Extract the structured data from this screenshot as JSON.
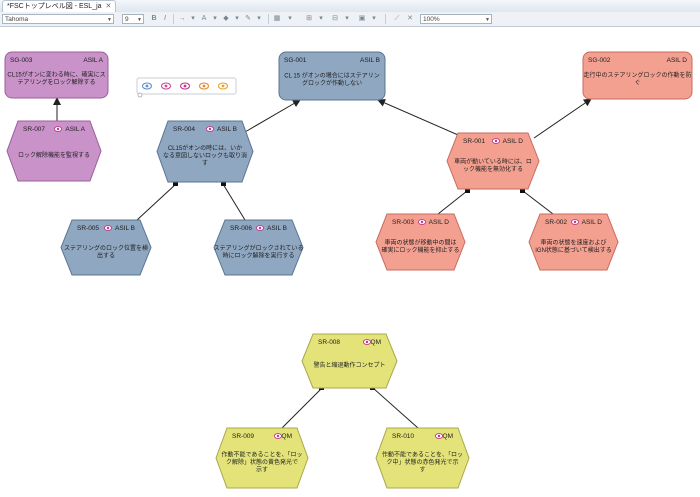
{
  "tab": {
    "title": "*FSCトップレベル図 - ESL_ja",
    "close": "✕"
  },
  "toolbar": {
    "font": "Tahoma",
    "size": "9",
    "zoom": "100%"
  },
  "palette": {
    "colors": [
      "#5b8fd6",
      "#d14b9b",
      "#c2388e",
      "#e88a2b",
      "#e5a52f"
    ]
  },
  "nodes": [
    {
      "id": "SG-003",
      "asil": "ASIL A",
      "text1": "CL15がオンに変わる時に、確実にス",
      "text2": "テアリングをロック解除する",
      "fill": "#c992c9",
      "stroke": "#9b5f9b"
    },
    {
      "id": "SG-001",
      "asil": "ASIL B",
      "text1": "CL 15 がオンの場合にはステアリン",
      "text2": "グロックが作動しない",
      "fill": "#8fa7c0",
      "stroke": "#5b7591"
    },
    {
      "id": "SG-002",
      "asil": "ASIL D",
      "text1": "走行中のステアリングロックの作動を防",
      "text2": "ぐ",
      "fill": "#f4a091",
      "stroke": "#c96a5d"
    },
    {
      "id": "SR-007",
      "asil": "ASIL A",
      "text1": "ロック解除機能を監視する",
      "text2": "",
      "fill": "#c992c9",
      "stroke": "#9b5f9b"
    },
    {
      "id": "SR-004",
      "asil": "ASIL B",
      "text1": "CL15がオンの時には、いか",
      "text2": "なる意図しないロックも取り消",
      "text3": "す",
      "fill": "#8fa7c0",
      "stroke": "#5b7591"
    },
    {
      "id": "SR-001",
      "asil": "ASIL D",
      "text1": "車両が動いている時には、ロ",
      "text2": "ック機能を無効化する",
      "fill": "#f4a091",
      "stroke": "#c96a5d"
    },
    {
      "id": "SR-005",
      "asil": "ASIL B",
      "text1": "ステアリングのロック位置を検",
      "text2": "出する",
      "fill": "#8fa7c0",
      "stroke": "#5b7591"
    },
    {
      "id": "SR-006",
      "asil": "ASIL B",
      "text1": "ステアリングがロックされている",
      "text2": "時にロック解除を実行する",
      "fill": "#8fa7c0",
      "stroke": "#5b7591"
    },
    {
      "id": "SR-003",
      "asil": "ASIL D",
      "text1": "車両の状態が移動中の間は",
      "text2": "確実にロック機能を抑止する",
      "fill": "#f4a091",
      "stroke": "#c96a5d"
    },
    {
      "id": "SR-002",
      "asil": "ASIL D",
      "text1": "車両の状態を速度および",
      "text2": "IGN状態に基づいて検出する",
      "fill": "#f4a091",
      "stroke": "#c96a5d"
    },
    {
      "id": "SR-008",
      "asil": "QM",
      "text1": "警告と縮退動作コンセプト",
      "text2": "",
      "fill": "#e3e37a",
      "stroke": "#a8a84a"
    },
    {
      "id": "SR-009",
      "asil": "QM",
      "text1": "作動不能であることを、「ロッ",
      "text2": "ク解除」状態の黄色発光で",
      "text3": "示す",
      "fill": "#e3e37a",
      "stroke": "#a8a84a"
    },
    {
      "id": "SR-010",
      "asil": "QM",
      "text1": "作動不能であることを、「ロッ",
      "text2": "ク中」状態の赤色発光で示",
      "text3": "す",
      "fill": "#e3e37a",
      "stroke": "#a8a84a"
    }
  ]
}
